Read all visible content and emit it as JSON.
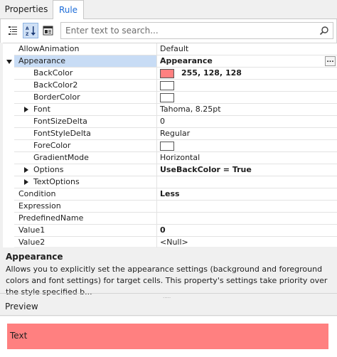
{
  "tabs": [
    {
      "label": "Properties",
      "active": false
    },
    {
      "label": "Rule",
      "active": true
    }
  ],
  "toolbar": {
    "buttons": [
      {
        "icon": "categorized-icon",
        "pressed": false
      },
      {
        "icon": "sort-az-icon",
        "pressed": true
      },
      {
        "icon": "property-pages-icon",
        "pressed": false
      }
    ],
    "search_placeholder": "Enter text to search...",
    "search_icon": "search-icon"
  },
  "grid": {
    "rows": [
      {
        "name": "AllowAnimation",
        "value": "Default",
        "level": 0
      },
      {
        "name": "Appearance",
        "value": "Appearance",
        "level": 0,
        "expanded": true,
        "selected": true,
        "bold_value": true,
        "has_button": true,
        "button_label": "..."
      },
      {
        "name": "BackColor",
        "value": "255, 128, 128",
        "level": 1,
        "swatch": "#ff8080",
        "bold_value": true
      },
      {
        "name": "BackColor2",
        "value": "",
        "level": 1,
        "swatch": "#ffffff"
      },
      {
        "name": "BorderColor",
        "value": "",
        "level": 1,
        "swatch": "#ffffff"
      },
      {
        "name": "Font",
        "value": "Tahoma, 8.25pt",
        "level": 1,
        "collapsed": true
      },
      {
        "name": "FontSizeDelta",
        "value": "0",
        "level": 1
      },
      {
        "name": "FontStyleDelta",
        "value": "Regular",
        "level": 1
      },
      {
        "name": "ForeColor",
        "value": "",
        "level": 1,
        "swatch": "#ffffff"
      },
      {
        "name": "GradientMode",
        "value": "Horizontal",
        "level": 1
      },
      {
        "name": "Options",
        "value": "UseBackColor = True",
        "level": 1,
        "collapsed": true,
        "bold_value": true
      },
      {
        "name": "TextOptions",
        "value": "",
        "level": 1,
        "collapsed": true
      },
      {
        "name": "Condition",
        "value": "Less",
        "level": 0,
        "bold_value": true
      },
      {
        "name": "Expression",
        "value": "",
        "level": 0
      },
      {
        "name": "PredefinedName",
        "value": "",
        "level": 0
      },
      {
        "name": "Value1",
        "value": "0",
        "level": 0,
        "bold_value": true
      },
      {
        "name": "Value2",
        "value": "<Null>",
        "level": 0
      }
    ]
  },
  "description": {
    "title": "Appearance",
    "text": "Allows you to explicitly set the appearance settings (background and foreground colors and font settings) for target cells. This property's settings take priority over the style specified b..."
  },
  "preview": {
    "header": "Preview",
    "text": "Text",
    "back_color": "#ff8080"
  },
  "colors": {
    "accent": "#1c6cd8",
    "selection": "#c8dcf5"
  }
}
